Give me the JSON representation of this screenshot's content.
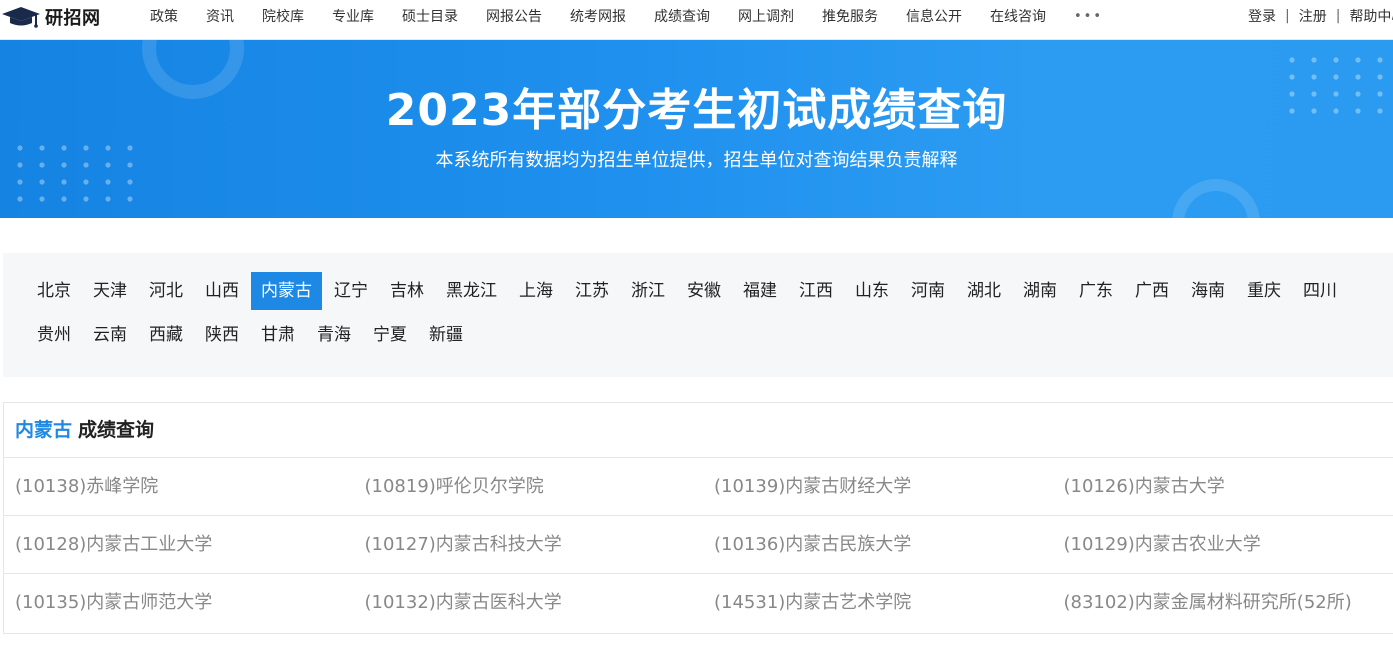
{
  "header": {
    "logo_text": "研招网",
    "nav": [
      "政策",
      "资讯",
      "院校库",
      "专业库",
      "硕士目录",
      "网报公告",
      "统考网报",
      "成绩查询",
      "网上调剂",
      "推免服务",
      "信息公开",
      "在线咨询"
    ],
    "more": "•••",
    "login": "登录",
    "register": "注册",
    "help": "帮助中心",
    "separator": "|"
  },
  "banner": {
    "title": "2023年部分考生初试成绩查询",
    "subtitle": "本系统所有数据均为招生单位提供，招生单位对查询结果负责解释"
  },
  "provinces": {
    "row1": [
      "北京",
      "天津",
      "河北",
      "山西",
      "内蒙古",
      "辽宁",
      "吉林",
      "黑龙江",
      "上海",
      "江苏",
      "浙江",
      "安徽",
      "福建",
      "江西",
      "山东",
      "河南",
      "湖北",
      "湖南",
      "广东",
      "广西",
      "海南",
      "重庆",
      "四川"
    ],
    "row2": [
      "贵州",
      "云南",
      "西藏",
      "陕西",
      "甘肃",
      "青海",
      "宁夏",
      "新疆"
    ],
    "active": "内蒙古"
  },
  "results": {
    "province": "内蒙古",
    "title_suffix": "成绩查询",
    "rows": [
      [
        "(10138)赤峰学院",
        "(10819)呼伦贝尔学院",
        "(10139)内蒙古财经大学",
        "(10126)内蒙古大学"
      ],
      [
        "(10128)内蒙古工业大学",
        "(10127)内蒙古科技大学",
        "(10136)内蒙古民族大学",
        "(10129)内蒙古农业大学"
      ],
      [
        "(10135)内蒙古师范大学",
        "(10132)内蒙古医科大学",
        "(14531)内蒙古艺术学院",
        "(83102)内蒙金属材料研究所(52所)"
      ]
    ]
  },
  "colors": {
    "accent": "#1e88e5",
    "banner": "#1f90ee"
  }
}
